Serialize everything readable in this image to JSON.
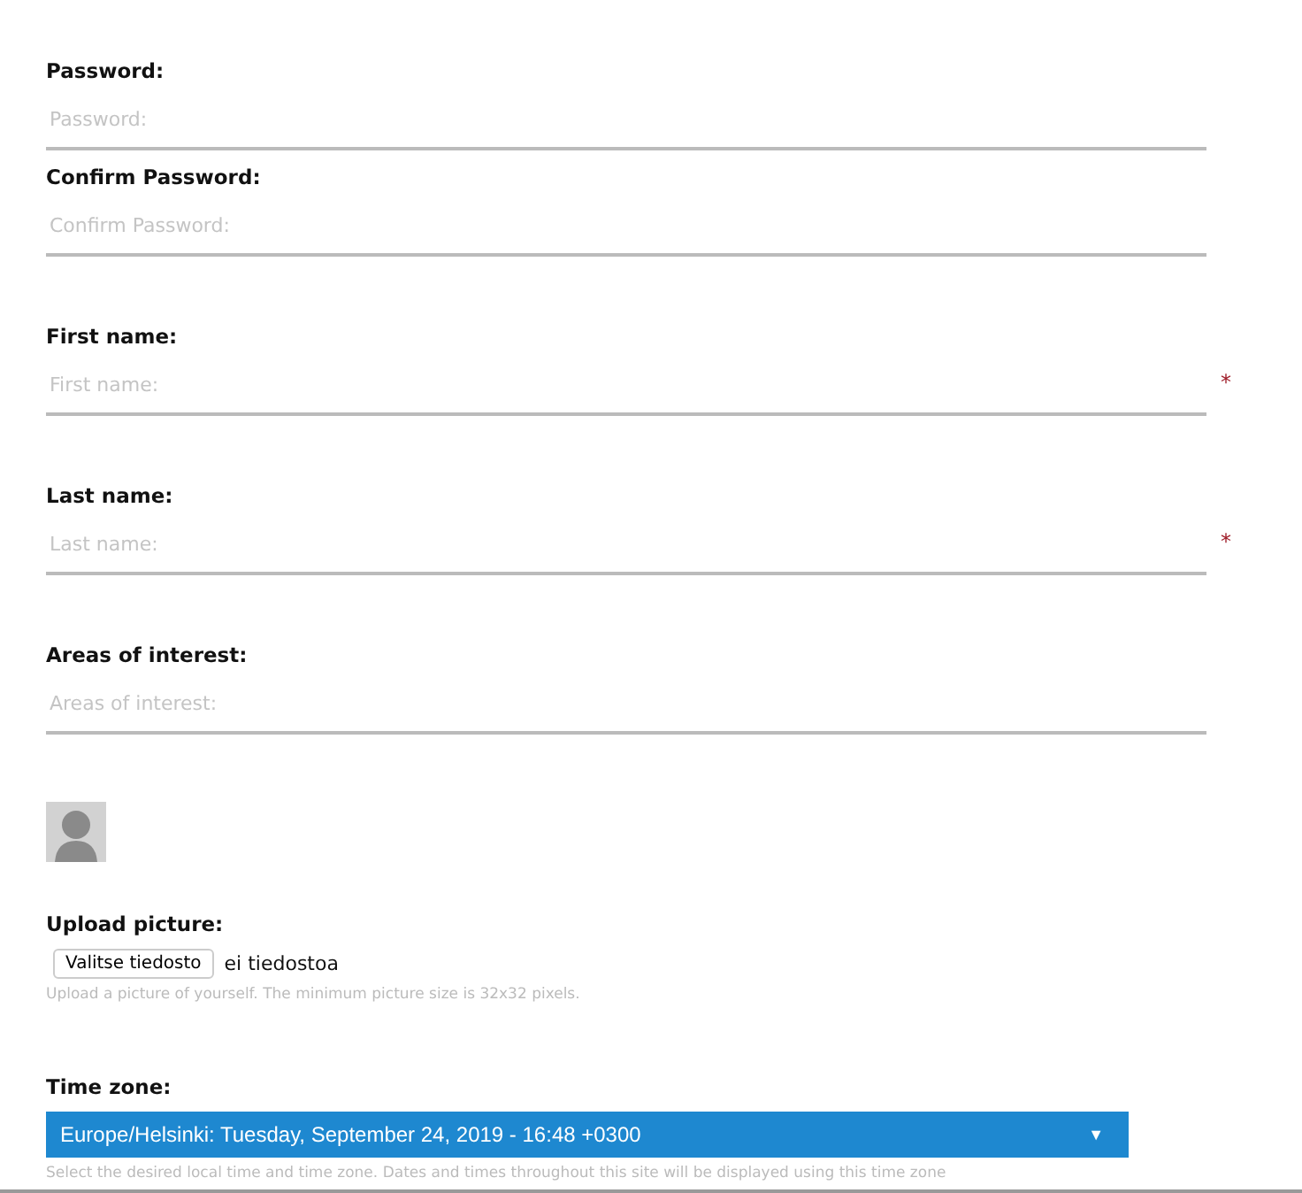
{
  "field_groups": [
    [
      {
        "label": "Password:",
        "placeholder": "Password:",
        "required": false
      },
      {
        "label": "Confirm Password:",
        "placeholder": "Confirm Password:",
        "required": false
      }
    ],
    [
      {
        "label": "First name:",
        "placeholder": "First name:",
        "required": true
      }
    ],
    [
      {
        "label": "Last name:",
        "placeholder": "Last name:",
        "required": true
      }
    ],
    [
      {
        "label": "Areas of interest:",
        "placeholder": "Areas of interest:",
        "required": false
      }
    ]
  ],
  "required_mark": "*",
  "upload": {
    "label": "Upload picture:",
    "button": "Valitse tiedosto",
    "status": "ei tiedostoa",
    "help": "Upload a picture of yourself. The minimum picture size is 32x32 pixels."
  },
  "time_zone": {
    "label": "Time zone:",
    "value": "Europe/Helsinki: Tuesday, September 24, 2019 - 16:48 +0300",
    "caret": "▼",
    "help": "Select the desired local time and time zone. Dates and times throughout this site will be displayed using this time zone"
  }
}
